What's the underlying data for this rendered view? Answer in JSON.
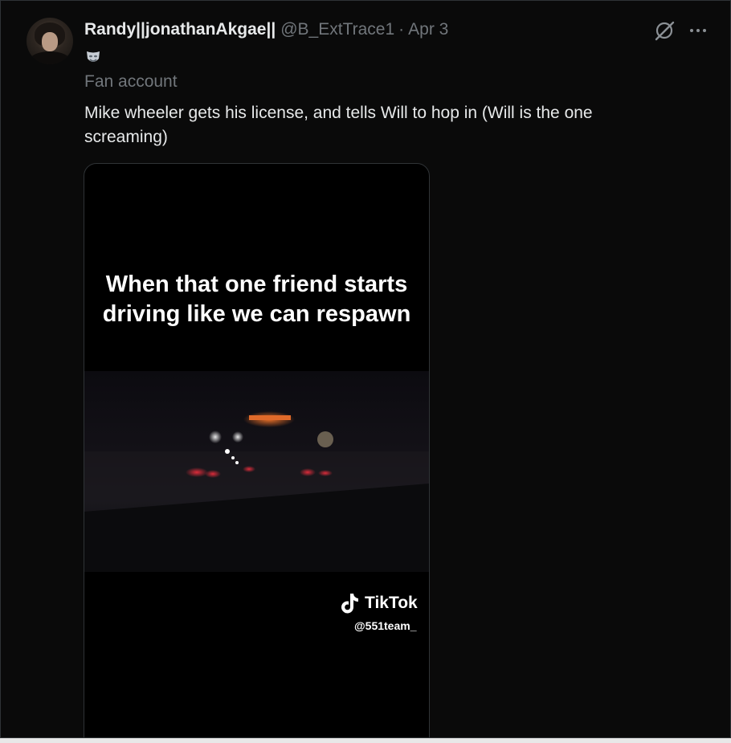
{
  "tweet": {
    "display_name": "Randy||jonathanAkgae||",
    "handle": "@B_ExtTrace1",
    "separator": "·",
    "date": "Apr 3",
    "badge_emoji": "performing-arts",
    "subtitle": "Fan account",
    "text": "Mike wheeler gets his license, and tells Will to hop in (Will is the one screaming)"
  },
  "media": {
    "caption": "When that one friend starts driving like we can respawn",
    "watermark_brand": "TikTok",
    "watermark_user": "@551team_"
  },
  "icons": {
    "grok": "grok-icon",
    "more": "more-icon"
  },
  "colors": {
    "background": "#0a0a0a",
    "primary_text": "#e7e9ea",
    "secondary_text": "#71767b",
    "border": "#2f3336"
  }
}
